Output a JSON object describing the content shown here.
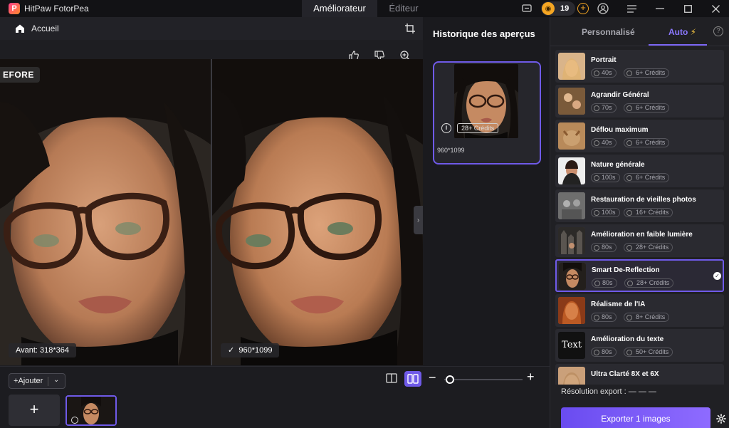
{
  "app": {
    "name": "HitPaw FotorPea"
  },
  "tabs": {
    "enhancer": "Améliorateur",
    "editor": "Éditeur"
  },
  "credits": {
    "count": "19"
  },
  "workspace": {
    "home_label": "Accueil",
    "before_label": "EFORE",
    "before_size": "Avant: 318*364",
    "after_size": "960*1099"
  },
  "history": {
    "title": "Historique des aperçus",
    "card_credits": "28+ Crédits",
    "card_resolution": "960*1099"
  },
  "bottom": {
    "add_label": "Ajouter"
  },
  "right_panel": {
    "tab_custom": "Personnalisé",
    "tab_auto": "Auto",
    "export_resolution_label": "Résolution export :",
    "export_resolution_value": "— — —",
    "export_button": "Exporter 1 images",
    "models": [
      {
        "name": "Portrait",
        "time": "40s",
        "credits": "6+ Crédits",
        "thumb": "#d9b48a"
      },
      {
        "name": "Agrandir Général",
        "time": "70s",
        "credits": "6+ Crédits",
        "thumb": "#a87c5a"
      },
      {
        "name": "Déflou maximum",
        "time": "40s",
        "credits": "6+ Crédits",
        "thumb": "#b88a5a"
      },
      {
        "name": "Nature générale",
        "time": "100s",
        "credits": "6+ Crédits",
        "thumb": "#7a5a4a"
      },
      {
        "name": "Restauration de vieilles photos",
        "time": "100s",
        "credits": "16+ Crédits",
        "thumb": "#8a8a8a"
      },
      {
        "name": "Amélioration en faible lumière",
        "time": "80s",
        "credits": "28+ Crédits",
        "thumb": "#4a4540"
      },
      {
        "name": "Smart De-Reflection",
        "time": "80s",
        "credits": "28+ Crédits",
        "thumb": "#5a4a44"
      },
      {
        "name": "Réalisme de l'IA",
        "time": "80s",
        "credits": "8+ Crédits",
        "thumb": "#c2703a"
      },
      {
        "name": "Amélioration du texte",
        "time": "80s",
        "credits": "50+ Crédits",
        "thumb": "#111111"
      },
      {
        "name": "Ultra Clarté 8X et 6X",
        "time": "",
        "credits": "",
        "thumb": "#caa07a"
      }
    ],
    "text_thumb_label": "Text"
  }
}
